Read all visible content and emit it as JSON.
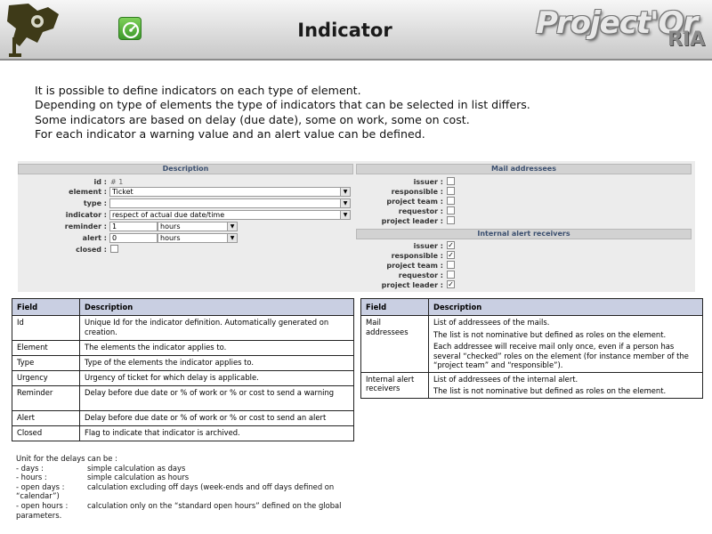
{
  "header": {
    "title": "Indicator",
    "brand_main": "Project'Or",
    "brand_sub": "RIA",
    "icons": [
      "app-logo-icon",
      "indicator-gauge-icon"
    ]
  },
  "intro": [
    "It is possible to define indicators on each type of element.",
    "Depending on type of elements the type of indicators that can be selected in list differs.",
    "Some indicators are based on delay (due date), some on work, some on cost.",
    "For each indicator a warning value and an alert value can be defined."
  ],
  "form": {
    "description_header": "Description",
    "id_label": "id :",
    "id_value": "# 1",
    "element_label": "element :",
    "element_value": "Ticket",
    "type_label": "type :",
    "type_value": "",
    "indicator_label": "indicator :",
    "indicator_value": "respect of actual due date/time",
    "reminder_label": "reminder :",
    "reminder_value": "1",
    "reminder_unit": "hours",
    "alert_label": "alert :",
    "alert_value": "0",
    "alert_unit": "hours",
    "closed_label": "closed :",
    "mail_header": "Mail addressees",
    "mail_roles": [
      {
        "label": "issuer :",
        "checked": false
      },
      {
        "label": "responsible :",
        "checked": false
      },
      {
        "label": "project team :",
        "checked": false
      },
      {
        "label": "requestor :",
        "checked": false
      },
      {
        "label": "project leader :",
        "checked": false
      }
    ],
    "internal_header": "Internal alert receivers",
    "internal_roles": [
      {
        "label": "issuer :",
        "checked": true
      },
      {
        "label": "responsible :",
        "checked": true
      },
      {
        "label": "project team :",
        "checked": false
      },
      {
        "label": "requestor :",
        "checked": false
      },
      {
        "label": "project leader :",
        "checked": true
      }
    ],
    "check_mark": "✓"
  },
  "left_table": {
    "headers": [
      "Field",
      "Description"
    ],
    "rows": [
      [
        "Id",
        "Unique Id for the indicator definition. Automatically generated on creation."
      ],
      [
        "Element",
        "The elements the indicator applies to."
      ],
      [
        "Type",
        "Type of the elements the indicator applies to."
      ],
      [
        "Urgency",
        "Urgency of ticket for which delay is applicable."
      ],
      [
        "Reminder",
        "Delay before due date or % of work or % or cost to send a warning"
      ],
      [
        "Alert",
        "Delay before due date or % of work or % or cost to send an alert"
      ],
      [
        "Closed",
        "Flag to indicate that indicator is archived."
      ]
    ]
  },
  "right_table": {
    "headers": [
      "Field",
      "Description"
    ],
    "rows": [
      {
        "field": "Mail addressees",
        "desc": [
          "List of addressees of the mails.",
          "The list is not nominative but defined as roles on the element.",
          "Each addressee will receive mail only once, even if a person has several “checked” roles on the element (for instance member of the “project team” and “responsible”)."
        ]
      },
      {
        "field": "Internal alert receivers",
        "desc": [
          "List of addressees of the internal alert.",
          "The list is not nominative but defined as roles on the element."
        ]
      }
    ]
  },
  "units": {
    "intro": "Unit for the delays can be :",
    "items": [
      {
        "term": " - days :",
        "desc": "simple calculation as days"
      },
      {
        "term": " - hours :",
        "desc": "simple calculation as hours"
      },
      {
        "term": " - open days :",
        "desc": "calculation excluding off days (week-ends and off days defined on “calendar”)"
      },
      {
        "term": " - open hours :",
        "desc": "calculation only on the “standard open hours” defined on the global parameters."
      }
    ]
  }
}
